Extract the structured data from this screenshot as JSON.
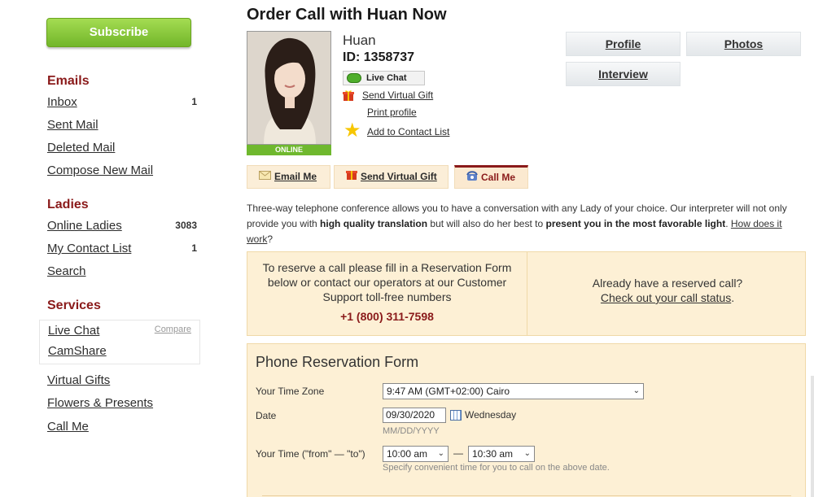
{
  "sidebar": {
    "subscribe_label": "Subscribe",
    "emails_heading": "Emails",
    "emails": [
      {
        "label": "Inbox",
        "count": "1"
      },
      {
        "label": "Sent Mail",
        "count": ""
      },
      {
        "label": "Deleted Mail",
        "count": ""
      },
      {
        "label": "Compose New Mail",
        "count": ""
      }
    ],
    "ladies_heading": "Ladies",
    "ladies": [
      {
        "label": "Online Ladies",
        "count": "3083"
      },
      {
        "label": "My Contact List",
        "count": "1"
      },
      {
        "label": "Search",
        "count": ""
      }
    ],
    "services_heading": "Services",
    "services_box": {
      "live_chat": "Live Chat",
      "compare": "Compare",
      "camshare": "CamShare"
    },
    "services_more": [
      "Virtual Gifts",
      "Flowers & Presents",
      "Call Me"
    ]
  },
  "page": {
    "title": "Order Call with Huan Now"
  },
  "profile": {
    "name": "Huan",
    "id_label": "ID: 1358737",
    "online_label": "ONLINE",
    "live_chat_label": "Live Chat",
    "send_gift_label": "Send Virtual Gift",
    "print_label": "Print profile",
    "add_contact_label": "Add to Contact List"
  },
  "top_tabs": {
    "profile": "Profile",
    "photos": "Photos",
    "interview": "Interview"
  },
  "action_tabs": {
    "email": "Email Me",
    "gift": "Send Virtual Gift",
    "call": "Call Me"
  },
  "intro": {
    "part1": "Three-way telephone conference allows you to have a conversation with any Lady of your choice. Our interpreter will not only provide you with ",
    "bold1": "high quality translation",
    "part2": " but will also do her best to ",
    "bold2": "present you in the most favorable light",
    "part3": ". ",
    "link": "How does it work",
    "part4": "?"
  },
  "reserve": {
    "left_text_1": "To reserve a call please fill in a Reservation Form",
    "left_text_2": "below or contact our operators at our Customer",
    "left_text_3": "Support toll-free numbers",
    "phone": "+1 (800) 311-7598",
    "right_text": "Already have a reserved call?",
    "right_link": "Check out your call status",
    "right_tail": "."
  },
  "form": {
    "title": "Phone Reservation Form",
    "timezone_label": "Your Time Zone",
    "timezone_value": "9:47 AM (GMT+02:00) Cairo",
    "date_label": "Date",
    "date_value": "09/30/2020",
    "date_day": "Wednesday",
    "date_hint": "MM/DD/YYYY",
    "time_label": "Your Time (\"from\" — \"to\")",
    "time_from": "10:00 am",
    "time_dash": "—",
    "time_to": "10:30 am",
    "time_hint": "Specify convenient time for you to call on the above date."
  },
  "colors": {
    "accent": "#8a1a1a",
    "subscribe_green": "#72b62a",
    "panel_bg": "#fdf0d5"
  }
}
